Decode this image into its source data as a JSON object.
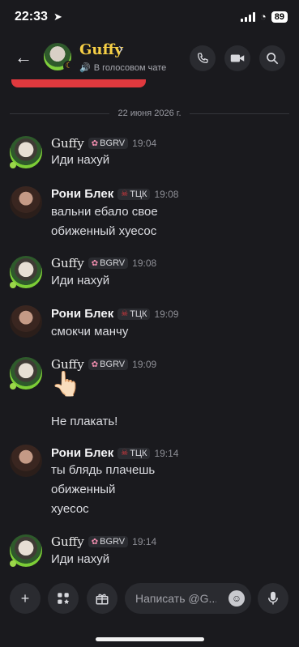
{
  "status_bar": {
    "time": "22:33",
    "battery": "89"
  },
  "header": {
    "name": "Guffy",
    "subtitle": "В голосовом чате"
  },
  "date_divider": "22 июня 2026 г.",
  "messages": [
    {
      "user": "Guffy",
      "tag": "BGRV",
      "time": "19:04",
      "lines": [
        "Иди нахуй"
      ]
    },
    {
      "user": "Рони Блек",
      "tag": "ТЦК",
      "time": "19:08",
      "lines": [
        "вальни ебало свое",
        "обиженный хуесос"
      ]
    },
    {
      "user": "Guffy",
      "tag": "BGRV",
      "time": "19:08",
      "lines": [
        "Иди нахуй"
      ]
    },
    {
      "user": "Рони Блек",
      "tag": "ТЦК",
      "time": "19:09",
      "lines": [
        "смокчи манчу"
      ]
    },
    {
      "user": "Guffy",
      "tag": "BGRV",
      "time": "19:09",
      "emoji": "👆🏻",
      "lines": [
        "Не плакать!"
      ]
    },
    {
      "user": "Рони Блек",
      "tag": "ТЦК",
      "time": "19:14",
      "lines": [
        "ты блядь плачешь",
        "обиженный",
        "хуесос"
      ]
    },
    {
      "user": "Guffy",
      "tag": "BGRV",
      "time": "19:14",
      "lines": [
        "Иди нахуй"
      ]
    }
  ],
  "composer": {
    "placeholder": "Написать @G..."
  },
  "icons": {
    "back": "back-arrow-icon",
    "call": "phone-call-icon",
    "video": "video-camera-icon",
    "search": "search-icon",
    "add": "plus-icon",
    "apps": "apps-icon",
    "gift": "gift-icon",
    "emoji": "emoji-icon",
    "mic": "microphone-icon"
  },
  "colors": {
    "accent_name": "#f7d046",
    "live_red": "#e0393e",
    "voice_green": "#3ba55d"
  }
}
